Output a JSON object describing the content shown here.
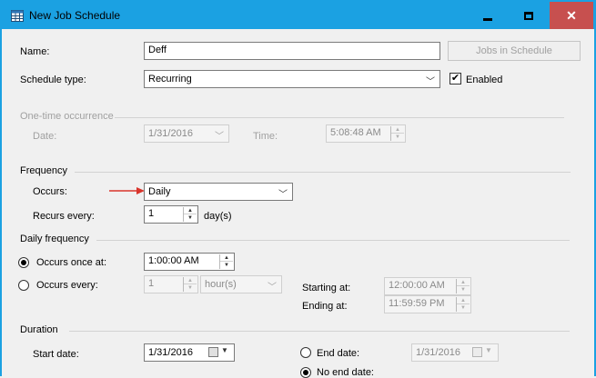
{
  "window": {
    "title": "New Job Schedule"
  },
  "general": {
    "name_label": "Name:",
    "name_value": "Deff",
    "jobs_button": "Jobs in Schedule",
    "schedule_type_label": "Schedule type:",
    "schedule_type_value": "Recurring",
    "enabled_label": "Enabled",
    "enabled_checked": true
  },
  "one_time": {
    "heading": "One-time occurrence",
    "date_label": "Date:",
    "date_value": "1/31/2016",
    "time_label": "Time:",
    "time_value": "5:08:48 AM"
  },
  "frequency": {
    "heading": "Frequency",
    "occurs_label": "Occurs:",
    "occurs_value": "Daily",
    "recurs_label": "Recurs every:",
    "recurs_value": "1",
    "recurs_unit": "day(s)"
  },
  "daily_frequency": {
    "heading": "Daily frequency",
    "once_label": "Occurs once at:",
    "once_value": "1:00:00 AM",
    "every_label": "Occurs every:",
    "every_value": "1",
    "every_unit": "hour(s)",
    "starting_label": "Starting at:",
    "starting_value": "12:00:00 AM",
    "ending_label": "Ending at:",
    "ending_value": "11:59:59 PM",
    "selected": "once"
  },
  "duration": {
    "heading": "Duration",
    "start_label": "Start date:",
    "start_value": "1/31/2016",
    "end_label": "End date:",
    "end_value": "1/31/2016",
    "no_end_label": "No end date:",
    "selected": "no_end"
  },
  "colors": {
    "title_bar": "#1ba1e2",
    "close_button": "#c7504f",
    "annotation_arrow": "#d9342b"
  }
}
